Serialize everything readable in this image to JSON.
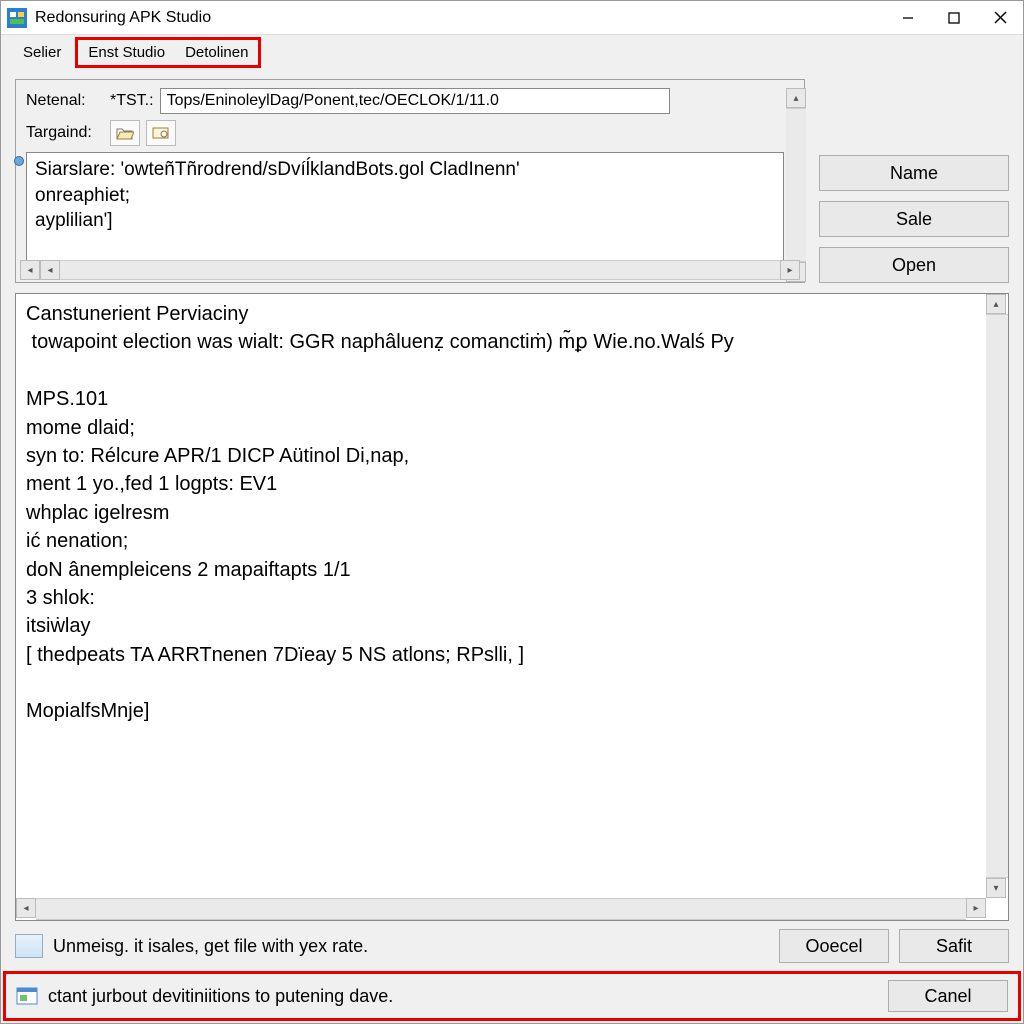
{
  "window": {
    "title": "Redonsuring APK Studio"
  },
  "menu": {
    "item1": "Selier",
    "item2": "Enst Studio",
    "item3": "Detolinen"
  },
  "form": {
    "netenal_label": "Netenal:",
    "netenal_prefix": "*TST.:",
    "netenal_value": "Tops/EninoleylDag/Ponent,tec/OECLOK/1/11.0",
    "targaind_label": "Targaind:"
  },
  "snippet": {
    "line1": "Siarslare: 'owteñTñrodrend/sDvíĺklandBots.gol CladInenn'",
    "line2": "onreaphiet;",
    "line3": "ayplilian']"
  },
  "side_buttons": {
    "name": "Name",
    "sale": "Sale",
    "open": "Open"
  },
  "log": "Canstunerient Perviaciny\n towapoint election was wialt: GGR naphâluenẓ comanctiṁ) m̃ꝑ Wie.no.Walś Py\n\nMPS.101\nmome dlaid;\nsyn to: Rélcure APR/1 DICP Aütinol Di,nap,\nment 1 yo.,fed 1 logpts: EV1\nwhplac igelresm\nić nenation;\ndoN ânempleicens 2 mapaiftapts 1/1\n3 shlok:\nitsiẇlay\n[ thedpeats TA ARRTnenen 7Dïeay 5 NS atlons; RPslli, ]\n\nMopialfsMnje]",
  "bottom": {
    "message": "Unmeisg. it isales, get file with yex rate.",
    "ok": "Ooecel",
    "safit": "Safit"
  },
  "status": {
    "text": "ctant jurbout devitiniitions to putening dave.",
    "cancel": "Canel"
  }
}
